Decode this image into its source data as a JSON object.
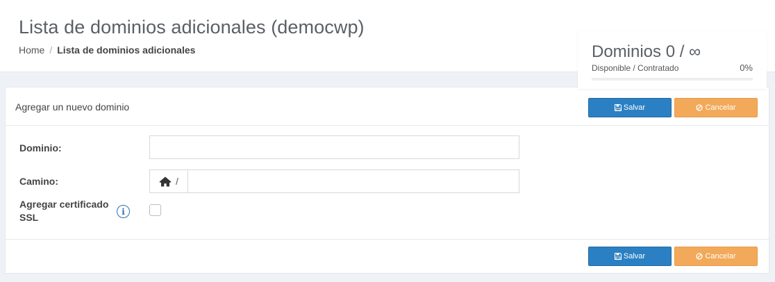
{
  "header": {
    "title": "Lista de dominios adicionales (democwp)",
    "breadcrumb": {
      "home": "Home",
      "separator": "/",
      "current": "Lista de dominios adicionales"
    }
  },
  "stats": {
    "title": "Dominios 0 / ∞",
    "subtitle": "Disponible / Contratado",
    "percent_label": "0%",
    "progress_fraction": 0
  },
  "form": {
    "heading": "Agregar un nuevo dominio",
    "domain_label": "Dominio:",
    "domain_value": "",
    "path_label": "Camino:",
    "path_prefix": "/",
    "path_value": "",
    "ssl_label_line1": "Agregar certificado",
    "ssl_label_line2": "SSL",
    "ssl_checked": false
  },
  "buttons": {
    "save": "Salvar",
    "cancel": "Cancelar"
  },
  "icons": {
    "save": "floppy-disk-icon",
    "cancel": "ban-icon",
    "home": "home-icon",
    "info": "info-circle-icon"
  },
  "colors": {
    "primary": "#2b80c3",
    "warning": "#f2a95a"
  }
}
